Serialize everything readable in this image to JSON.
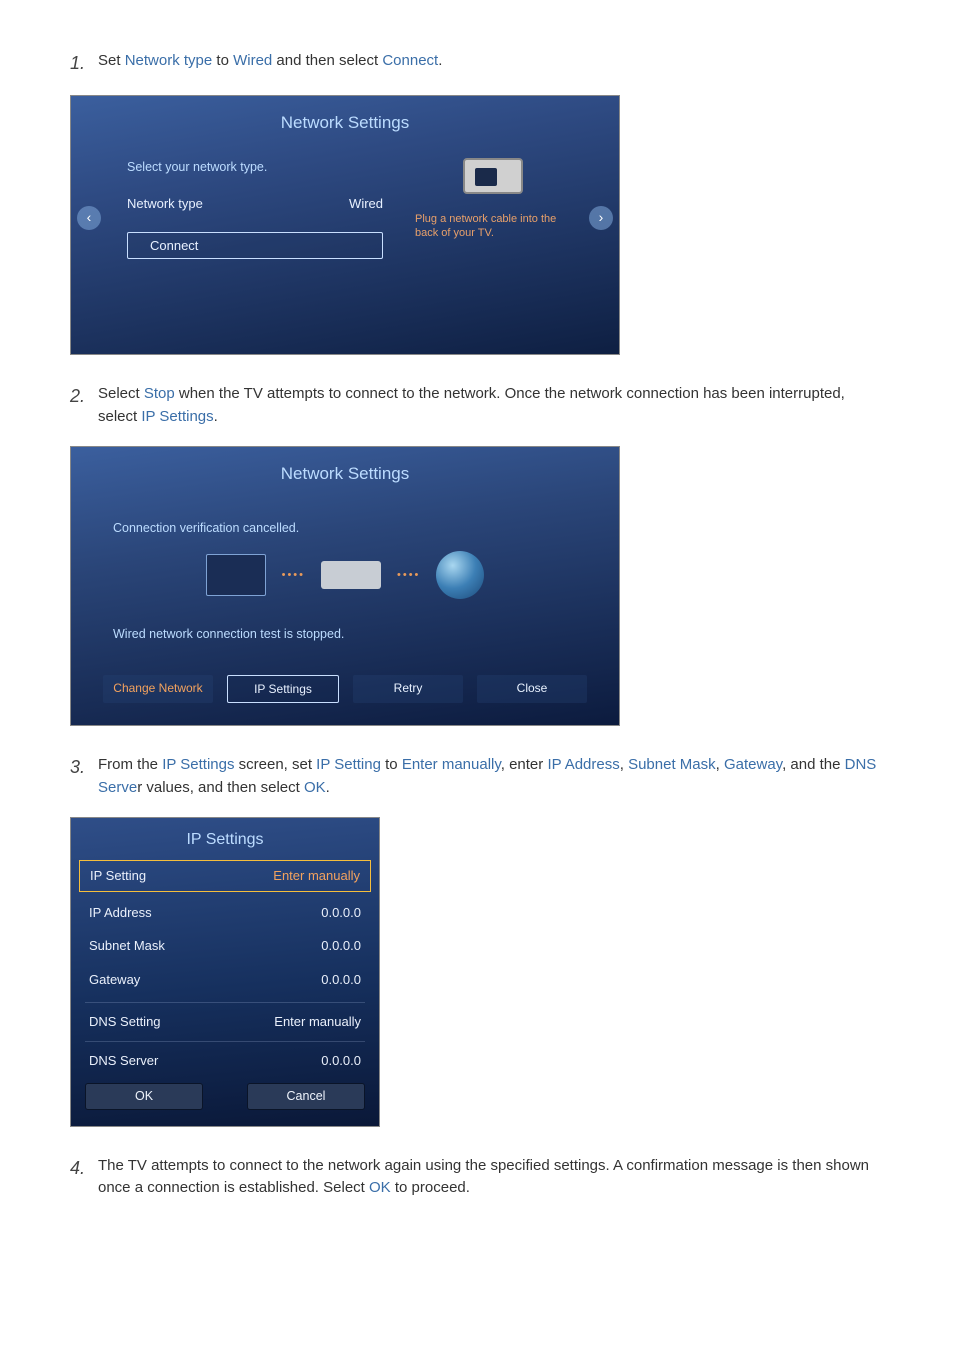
{
  "steps": {
    "s1": {
      "num": "1.",
      "pre": "Set ",
      "hl1": "Network type",
      "mid1": " to ",
      "hl2": "Wired",
      "mid2": " and then select ",
      "hl3": "Connect",
      "post": "."
    },
    "s2": {
      "num": "2.",
      "pre": "Select ",
      "hl1": "Stop",
      "mid1": " when the TV attempts to connect to the network. Once the network connection has been interrupted, select ",
      "hl2": "IP Settings",
      "post": "."
    },
    "s3": {
      "num": "3.",
      "pre": "From the ",
      "hl1": "IP Settings",
      "mid1": " screen, set ",
      "hl2": "IP Setting",
      "mid2": " to ",
      "hl3": "Enter manually",
      "mid3": ", enter ",
      "hl4": "IP Address",
      "mid4": ", ",
      "hl5": "Subnet Mask",
      "mid5": ", ",
      "hl6": "Gateway",
      "mid6": ", and the ",
      "hl7": "DNS Serve",
      "mid7": "r values, and then select ",
      "hl8": "OK",
      "post": "."
    },
    "s4": {
      "num": "4.",
      "pre": "The TV attempts to connect to the network again using the specified settings. A confirmation message is then shown once a connection is established. Select ",
      "hl1": "OK",
      "post": " to proceed."
    }
  },
  "ss1": {
    "title": "Network Settings",
    "subtitle": "Select your network type.",
    "nt_label": "Network type",
    "nt_value": "Wired",
    "connect": "Connect",
    "tip": "Plug a network cable into the back of your TV."
  },
  "ss2": {
    "title": "Network Settings",
    "subtitle": "Connection verification cancelled.",
    "status": "Wired network connection test is stopped.",
    "btn_change": "Change Network",
    "btn_ip": "IP Settings",
    "btn_retry": "Retry",
    "btn_close": "Close"
  },
  "ss3": {
    "title": "IP Settings",
    "row_ipsetting_l": "IP Setting",
    "row_ipsetting_r": "Enter manually",
    "row_ipaddr_l": "IP Address",
    "row_ipaddr_r": "0.0.0.0",
    "row_subnet_l": "Subnet Mask",
    "row_subnet_r": "0.0.0.0",
    "row_gateway_l": "Gateway",
    "row_gateway_r": "0.0.0.0",
    "row_dnsset_l": "DNS Setting",
    "row_dnsset_r": "Enter manually",
    "row_dnssrv_l": "DNS Server",
    "row_dnssrv_r": "0.0.0.0",
    "btn_ok": "OK",
    "btn_cancel": "Cancel"
  }
}
